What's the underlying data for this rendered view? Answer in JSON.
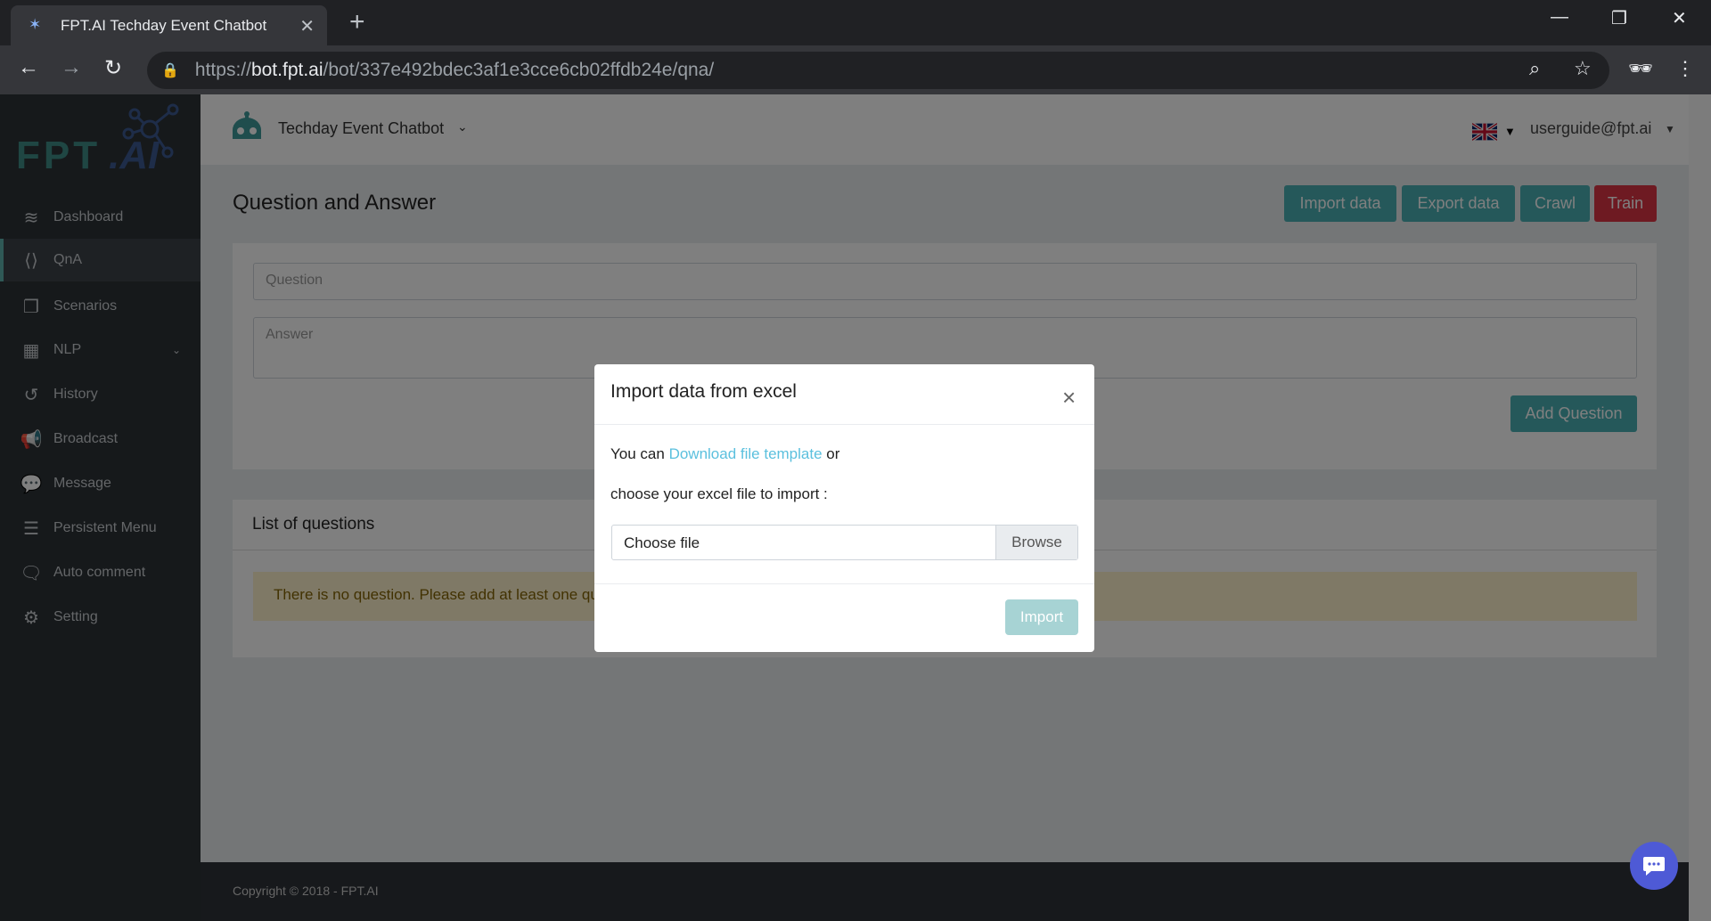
{
  "browser": {
    "tab_title": "FPT.AI Techday Event Chatbot",
    "url_scheme": "https://",
    "url_host": "bot.fpt.ai",
    "url_path": "/bot/337e492bdec3af1e3cce6cb02ffdb24e/qna/"
  },
  "header": {
    "bot_name": "Techday Event Chatbot",
    "user": "userguide@fpt.ai",
    "language_flag": "uk-flag-icon"
  },
  "logo": "FPT.AI",
  "sidebar": {
    "items": [
      {
        "label": "Dashboard",
        "icon": "layers-icon"
      },
      {
        "label": "QnA",
        "icon": "code-icon",
        "active": true
      },
      {
        "label": "Scenarios",
        "icon": "clone-icon"
      },
      {
        "label": "NLP",
        "icon": "nlp-icon"
      },
      {
        "label": "History",
        "icon": "history-icon"
      },
      {
        "label": "Broadcast",
        "icon": "megaphone-icon"
      },
      {
        "label": "Message",
        "icon": "message-icon"
      },
      {
        "label": "Persistent Menu",
        "icon": "menu-icon"
      },
      {
        "label": "Auto comment",
        "icon": "comment-icon"
      },
      {
        "label": "Setting",
        "icon": "gear-icon"
      }
    ]
  },
  "page": {
    "title": "Question and Answer",
    "buttons": {
      "import": "Import data",
      "export": "Export data",
      "crawl": "Crawl",
      "train": "Train"
    },
    "question_placeholder": "Question",
    "answer_placeholder": "Answer",
    "add_question": "Add Question",
    "list_title": "List of questions",
    "empty_alert": "There is no question. Please add at least one question."
  },
  "footer": {
    "copyright": "Copyright © 2018 - FPT.AI"
  },
  "modal": {
    "title": "Import data from excel",
    "text_prefix": "You can",
    "link": "Download file template",
    "text_suffix": "or",
    "line2": "choose your excel file to import :",
    "file_label": "Choose file",
    "browse": "Browse",
    "import": "Import"
  },
  "colors": {
    "teal": "#4bb1b5",
    "train_red": "#dc3545",
    "link": "#5bc0de",
    "chat_bubble": "#4e5ad6"
  }
}
